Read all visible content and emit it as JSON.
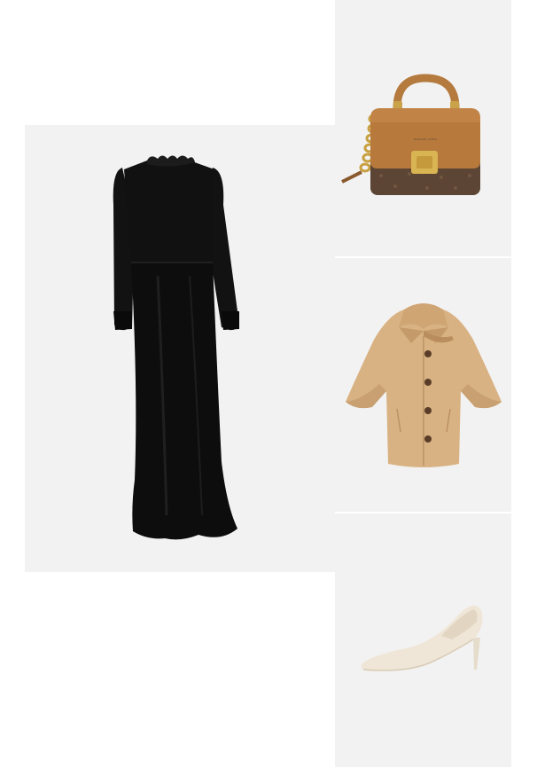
{
  "outfit": {
    "items": [
      {
        "id": "dress",
        "icon": "black-long-sleeve-maxi-dress-icon",
        "color": "#0d0d0d"
      },
      {
        "id": "handbag",
        "icon": "top-handle-crossbody-bag-icon",
        "color": "#b87a3e",
        "brand_text": "MICHAEL KORS"
      },
      {
        "id": "coat",
        "icon": "camel-cape-coat-icon",
        "color": "#d9b283"
      },
      {
        "id": "pumps",
        "icon": "cream-pointed-pump-icon",
        "color": "#efe6d8"
      }
    ]
  },
  "colors": {
    "tile_background": "#f2f2f2",
    "page_background": "#ffffff"
  }
}
